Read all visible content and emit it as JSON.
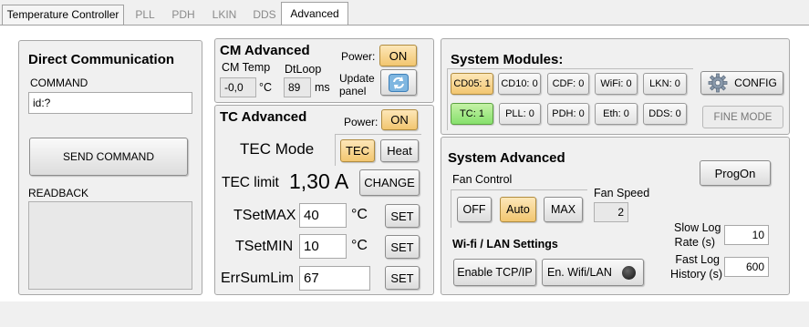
{
  "tabs": [
    "Temperature Controller",
    "PLL",
    "PDH",
    "LKIN",
    "DDS",
    "Advanced"
  ],
  "direct": {
    "title": "Direct Communication",
    "command_label": "COMMAND",
    "command_value": "id:?",
    "send_label": "SEND COMMAND",
    "readback_label": "READBACK"
  },
  "cm": {
    "title": "CM Advanced",
    "power_label": "Power:",
    "power_value": "ON",
    "temp_label": "CM Temp",
    "temp_value": "-0,0",
    "temp_unit": "°C",
    "dtloop_label": "DtLoop",
    "dtloop_value": "89",
    "dtloop_unit": "ms",
    "update_label_1": "Update",
    "update_label_2": "panel"
  },
  "tc": {
    "title": "TC Advanced",
    "power_label": "Power:",
    "power_value": "ON",
    "tec_mode_label": "TEC Mode",
    "tec_btn": "TEC",
    "heat_btn": "Heat",
    "tec_limit_label": "TEC limit",
    "tec_limit_value": "1,30 A",
    "change_btn": "CHANGE",
    "tsetmax_label": "TSetMAX",
    "tsetmax_value": "40",
    "tsetmin_label": "TSetMIN",
    "tsetmin_value": "10",
    "errsum_label": "ErrSumLim",
    "errsum_value": "67",
    "unit": "°C",
    "set_btn": "SET"
  },
  "modules": {
    "title": "System Modules:",
    "row1": [
      {
        "name": "CD05:",
        "value": "1",
        "state": "orange"
      },
      {
        "name": "CD10:",
        "value": "0",
        "state": "normal"
      },
      {
        "name": "CDF:",
        "value": "0",
        "state": "normal"
      },
      {
        "name": "WiFi:",
        "value": "0",
        "state": "normal"
      },
      {
        "name": "LKN:",
        "value": "0",
        "state": "normal"
      }
    ],
    "row2": [
      {
        "name": "TC:",
        "value": "1",
        "state": "green"
      },
      {
        "name": "PLL:",
        "value": "0",
        "state": "normal"
      },
      {
        "name": "PDH:",
        "value": "0",
        "state": "normal"
      },
      {
        "name": "Eth:",
        "value": "0",
        "state": "normal"
      },
      {
        "name": "DDS:",
        "value": "0",
        "state": "normal"
      }
    ],
    "config_btn": "CONFIG",
    "fine_mode_btn": "FINE MODE"
  },
  "sys": {
    "title": "System Advanced",
    "fan_control_label": "Fan Control",
    "fan_off": "OFF",
    "fan_auto": "Auto",
    "fan_max": "MAX",
    "fan_speed_label": "Fan Speed",
    "fan_speed_value": "2",
    "progon_btn": "ProgOn",
    "wifi_lan_label": "Wi-fi / LAN Settings",
    "enable_tcp_btn": "Enable TCP/IP",
    "en_wifi_btn": "En. Wifi/LAN",
    "slow_log_label_1": "Slow Log",
    "slow_log_label_2": "Rate (s)",
    "slow_log_value": "10",
    "fast_log_label_1": "Fast Log",
    "fast_log_label_2": "History (s)",
    "fast_log_value": "600"
  },
  "colors": {
    "active_orange": "#f2c670",
    "active_green": "#86e06c"
  }
}
